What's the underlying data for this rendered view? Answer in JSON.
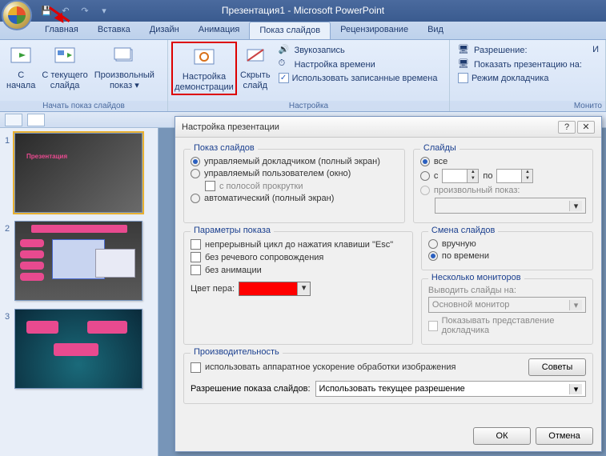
{
  "title": "Презентация1 - Microsoft PowerPoint",
  "qat": {
    "save": "save",
    "undo": "undo",
    "redo": "redo"
  },
  "tabs": [
    "Главная",
    "Вставка",
    "Дизайн",
    "Анимация",
    "Показ слайдов",
    "Рецензирование",
    "Вид"
  ],
  "active_tab": 4,
  "ribbon": {
    "group1": {
      "label": "Начать показ слайдов",
      "btn1": "С\nначала",
      "btn2": "С текущего\nслайда",
      "btn3": "Произвольный\nпоказ ▾"
    },
    "group2": {
      "btn1": "Настройка\nдемонстрации",
      "btn2": "Скрыть\nслайд",
      "line1": "Звукозапись",
      "line2": "Настройка времени",
      "line3": "Использовать записанные времена",
      "label": "Настройка"
    },
    "group3": {
      "line1": "Разрешение:",
      "line2": "Показать презентацию на:",
      "line3": "Режим докладчика",
      "label": "Монито"
    },
    "extra": "И"
  },
  "thumbs": [
    "1",
    "2",
    "3"
  ],
  "dialog": {
    "title": "Настройка презентации",
    "g_show": {
      "title": "Показ слайдов",
      "opt1": "управляемый докладчиком (полный экран)",
      "opt2": "управляемый пользователем (окно)",
      "opt2a": "с полосой прокрутки",
      "opt3": "автоматический (полный экран)"
    },
    "g_slides": {
      "title": "Слайды",
      "opt1": "все",
      "opt2": "с",
      "to": "по",
      "opt3": "произвольный показ:"
    },
    "g_params": {
      "title": "Параметры показа",
      "opt1": "непрерывный цикл до нажатия клавиши \"Esc\"",
      "opt2": "без речевого сопровождения",
      "opt3": "без анимации",
      "pen": "Цвет пера:"
    },
    "g_advance": {
      "title": "Смена слайдов",
      "opt1": "вручную",
      "opt2": "по времени"
    },
    "g_monitors": {
      "title": "Несколько мониторов",
      "line1": "Выводить слайды на:",
      "combo": "Основной монитор",
      "opt1": "Показывать представление докладчика"
    },
    "g_perf": {
      "title": "Производительность",
      "opt1": "использовать аппаратное ускорение обработки изображения",
      "tips": "Советы",
      "res_label": "Разрешение показа слайдов:",
      "res_value": "Использовать текущее разрешение"
    },
    "ok": "ОК",
    "cancel": "Отмена"
  }
}
